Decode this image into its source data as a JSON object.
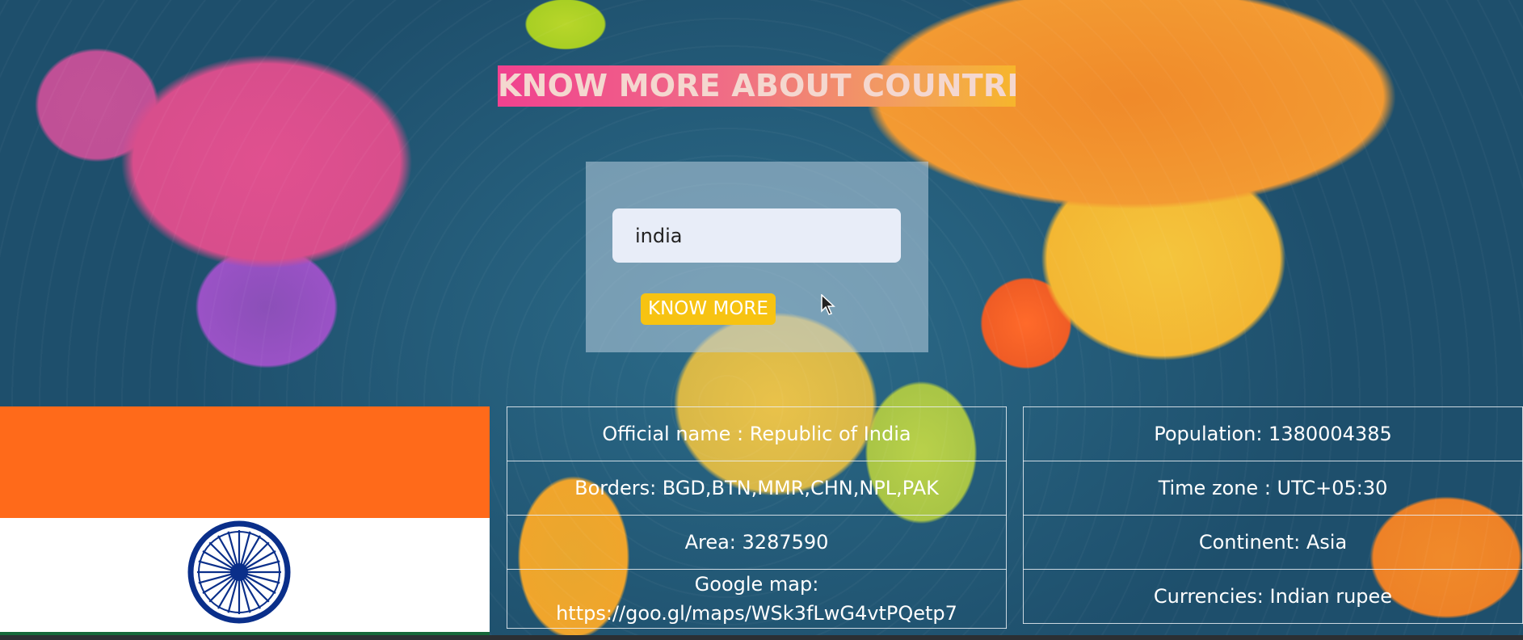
{
  "header": {
    "title": "KNOW MORE ABOUT COUNTRIES!"
  },
  "search": {
    "value": "india",
    "button_label": "KNOW MORE"
  },
  "flag": {
    "country": "India",
    "colors": [
      "#ff6a1a",
      "#ffffff",
      "#15683a"
    ],
    "chakra_color": "#0a2f8a"
  },
  "info_left": {
    "official_name": "Official name : Republic of India",
    "borders": "Borders: BGD,BTN,MMR,CHN,NPL,PAK",
    "area": "Area: 3287590",
    "google_map_label": "Google map:",
    "google_map_url": "https://goo.gl/maps/WSk3fLwG4vtPQetp7"
  },
  "info_right": {
    "population": "Population: 1380004385",
    "time_zone": "Time zone : UTC+05:30",
    "continent": "Continent: Asia",
    "currencies": "Currencies: Indian rupee"
  },
  "theme": {
    "accent": "#f7c312",
    "title_gradient": [
      "#f0418f",
      "#f6b52c"
    ]
  }
}
